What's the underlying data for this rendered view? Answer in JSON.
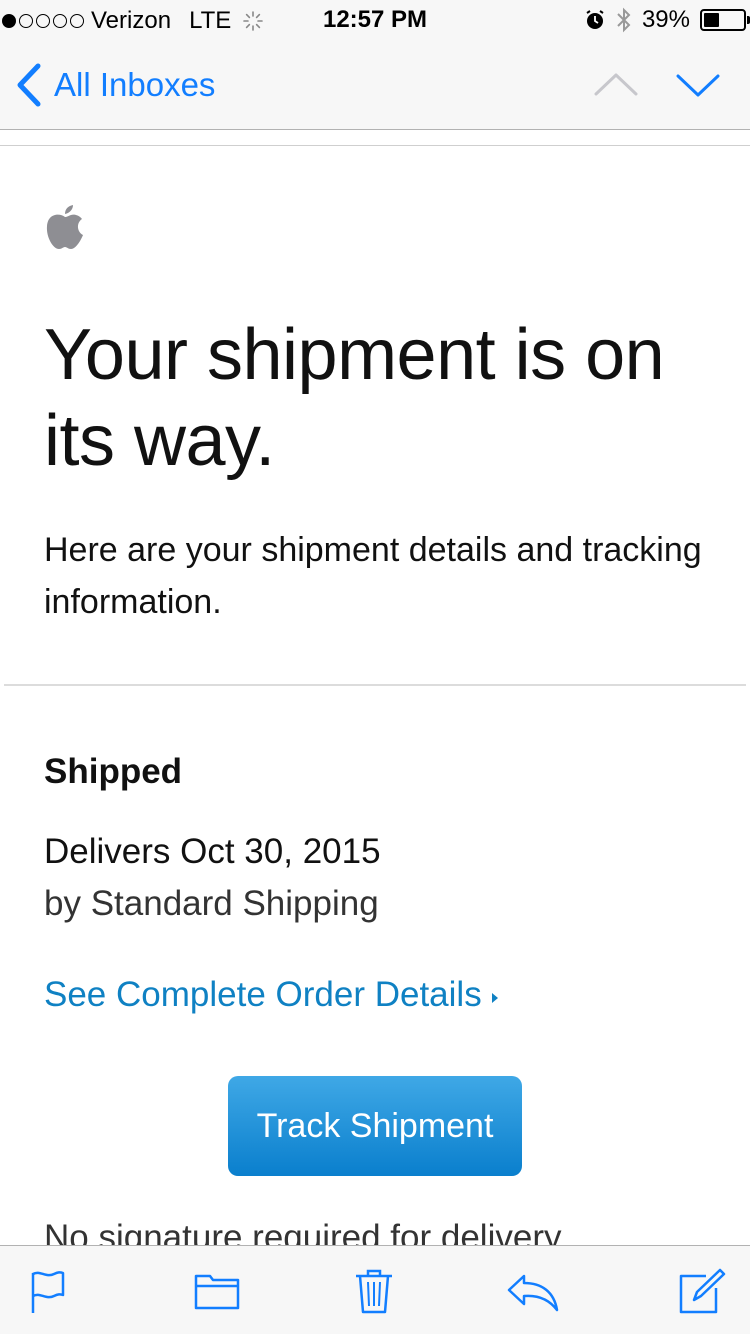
{
  "status_bar": {
    "carrier": "Verizon",
    "network": "LTE",
    "time": "12:57 PM",
    "battery_percent": "39%",
    "battery_level": 0.39,
    "signal_bars_filled": 1,
    "signal_bars_total": 5,
    "icons": [
      "activity-spinner-icon",
      "alarm-icon",
      "bluetooth-icon",
      "battery-icon"
    ]
  },
  "nav": {
    "back_label": "All Inboxes",
    "icons": [
      "chevron-left-icon",
      "chevron-up-icon",
      "chevron-down-icon"
    ],
    "accent_color": "#127eff",
    "disabled_color": "#c7c7cc"
  },
  "email": {
    "headline": "Your shipment is on its way.",
    "intro": "Here are your shipment details and tracking information.",
    "status_heading": "Shipped",
    "delivers": "Delivers Oct 30, 2015",
    "method": "by Standard Shipping",
    "order_link": "See Complete Order Details",
    "track_button": "Track Shipment",
    "signature_note": "No signature required for delivery",
    "link_color": "#0f81c3",
    "button_color": "#1d8fd8"
  },
  "toolbar": {
    "icons": [
      "flag-icon",
      "folder-icon",
      "trash-icon",
      "reply-icon",
      "compose-icon"
    ]
  }
}
